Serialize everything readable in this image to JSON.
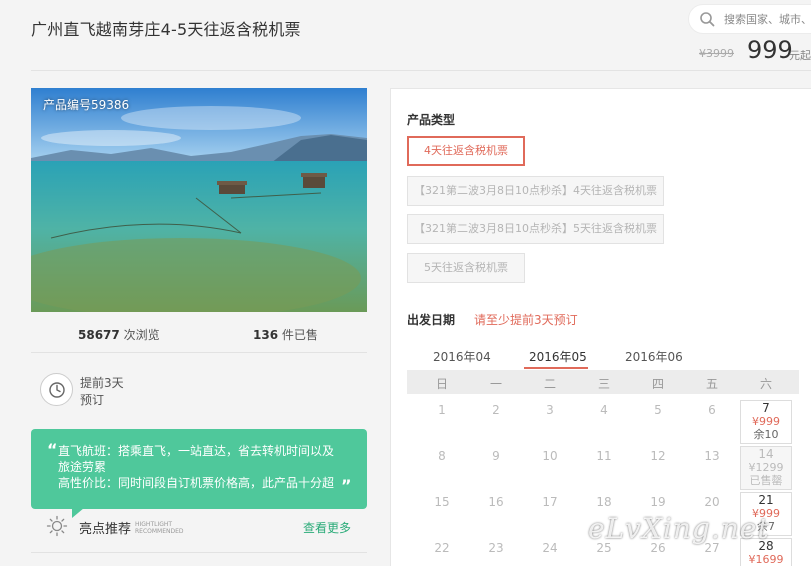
{
  "title": "广州直飞越南芽庄4-5天往返含税机票",
  "search": {
    "placeholder": "搜索国家、城市、"
  },
  "price": {
    "old": "¥3999",
    "current": "999",
    "unit": "元起"
  },
  "product": {
    "number_label": "产品编号59386",
    "views_count": "58677",
    "views_label": "次浏览",
    "sold_count": "136",
    "sold_label": "件已售"
  },
  "booking": {
    "line1": "提前3天",
    "line2": "预订"
  },
  "highlight": {
    "quote_open": "“",
    "quote_close": "”",
    "line1": "直飞航班：搭乘直飞，一站直达，省去转机时间以及",
    "line2": "旅途劳累",
    "line3": "高性价比：同时间段自订机票价格高，此产品十分超",
    "title": "亮点推荐",
    "en_line1": "HIGHTLIGHT",
    "en_line2": "RECOMMENDED",
    "more": "查看更多"
  },
  "product_type": {
    "label": "产品类型",
    "options": [
      "4天往返含税机票",
      "【321第二波3月8日10点秒杀】4天往返含税机票",
      "【321第二波3月8日10点秒杀】5天往返含税机票",
      "5天往返含税机票"
    ],
    "selected_index": 0
  },
  "departure": {
    "label": "出发日期",
    "hint": "请至少提前3天预订",
    "months": [
      "2016年04",
      "2016年05",
      "2016年06"
    ],
    "selected_month_index": 1,
    "weekdays": [
      "日",
      "一",
      "二",
      "三",
      "四",
      "五",
      "六"
    ],
    "rows": [
      [
        "1",
        "2",
        "3",
        "4",
        "5",
        "6"
      ],
      [
        "8",
        "9",
        "10",
        "11",
        "12",
        "13"
      ],
      [
        "15",
        "16",
        "17",
        "18",
        "19",
        "20"
      ],
      [
        "22",
        "23",
        "24",
        "25",
        "26",
        "27"
      ]
    ],
    "saturdays": [
      {
        "day": "7",
        "price": "¥999",
        "left": "余10",
        "sold_out": false
      },
      {
        "day": "14",
        "price": "¥1299",
        "left": "已售罄",
        "sold_out": true
      },
      {
        "day": "21",
        "price": "¥999",
        "left": "余7",
        "sold_out": false
      },
      {
        "day": "28",
        "price": "¥1699",
        "left": "",
        "sold_out": false
      }
    ]
  },
  "watermark": "eLvXing.net",
  "colors": {
    "accent": "#e06a5a",
    "green": "#4fc89b",
    "link_green": "#2bab79"
  }
}
